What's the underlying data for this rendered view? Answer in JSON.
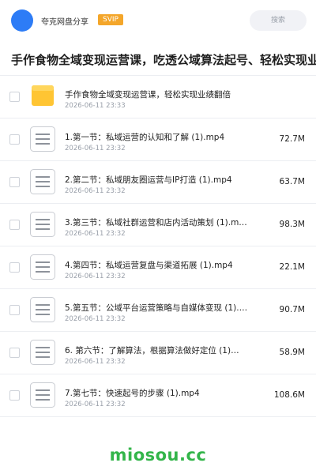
{
  "header": {
    "share_name": "夸克网盘分享",
    "badge": "SVIP",
    "search_placeholder": "搜索",
    "avatar_color": "#2d7cf6"
  },
  "page_title": "手作食物全域变现运营课，吃透公域算法起号、轻松实现业",
  "files": [
    {
      "type": "folder",
      "icon": "folder-icon",
      "name": "手作食物全域变现运营课，轻松实现业绩翻倍",
      "date": "2026-06-11 23:33",
      "size": ""
    },
    {
      "type": "file",
      "icon": "document-icon",
      "name": "1.第一节：私域运营的认知和了解 (1).mp4",
      "date": "2026-06-11 23:32",
      "size": "72.7M"
    },
    {
      "type": "file",
      "icon": "document-icon",
      "name": "2.第二节：私域朋友圈运营与IP打造 (1).mp4",
      "date": "2026-06-11 23:32",
      "size": "63.7M"
    },
    {
      "type": "file",
      "icon": "document-icon",
      "name": "3.第三节：私域社群运营和店内活动策划 (1).m…",
      "date": "2026-06-11 23:32",
      "size": "98.3M"
    },
    {
      "type": "file",
      "icon": "document-icon",
      "name": "4.第四节：私域运营复盘与渠道拓展 (1).mp4",
      "date": "2026-06-11 23:32",
      "size": "22.1M"
    },
    {
      "type": "file",
      "icon": "document-icon",
      "name": "5.第五节：公域平台运营策略与自媒体变现 (1).…",
      "date": "2026-06-11 23:32",
      "size": "90.7M"
    },
    {
      "type": "file",
      "icon": "document-icon",
      "name": "6. 第六节：了解算法，根据算法做好定位 (1)…",
      "date": "2026-06-11 23:32",
      "size": "58.9M"
    },
    {
      "type": "file",
      "icon": "document-icon",
      "name": "7.第七节：快速起号的步骤 (1).mp4",
      "date": "2026-06-11 23:32",
      "size": "108.6M"
    }
  ],
  "watermark": "miosou.cc",
  "colors": {
    "badge": "#f4a62a",
    "folder": "#ffc533",
    "watermark": "#33b54a"
  }
}
